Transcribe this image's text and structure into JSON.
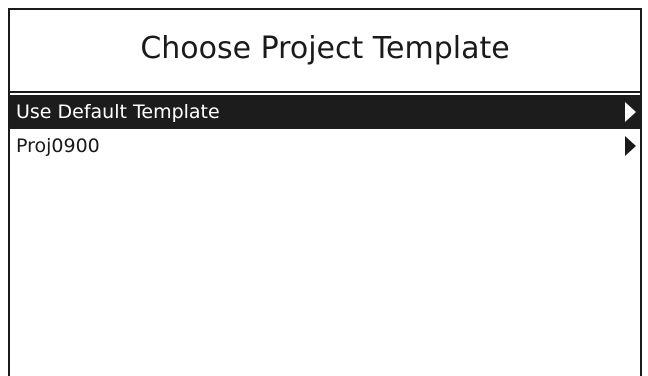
{
  "header": {
    "title": "Choose Project Template"
  },
  "list": {
    "items": [
      {
        "label": "Use Default Template",
        "selected": true,
        "icon": "chevron-right-icon"
      },
      {
        "label": "Proj0900",
        "selected": false,
        "icon": "chevron-right-icon"
      }
    ]
  },
  "colors": {
    "background": "#ffffff",
    "foreground": "#1a1a1a",
    "selected_background": "#1c1c1c",
    "selected_text": "#ffffff"
  }
}
